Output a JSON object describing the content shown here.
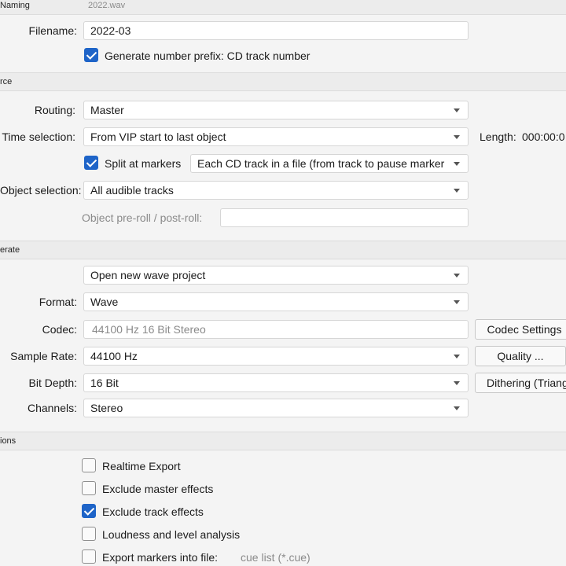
{
  "naming": {
    "section": "Naming",
    "preview": "2022.wav",
    "filename_label": "Filename:",
    "filename_value": "2022-03",
    "prefix_label": "Generate number prefix: CD track number",
    "prefix_checked": true
  },
  "source": {
    "section": "rce",
    "routing_label": "Routing:",
    "routing_value": "Master",
    "time_label": "Time selection:",
    "time_value": "From VIP start to last object",
    "length_label": "Length:",
    "length_value": "000:00:0",
    "split_label": "Split at markers",
    "split_checked": true,
    "split_mode": "Each CD track in a file (from track to pause marker",
    "object_label": "Object selection:",
    "object_value": "All audible tracks",
    "preroll_label": "Object pre-roll / post-roll:",
    "preroll_value": ""
  },
  "generate": {
    "section": "erate",
    "target_value": "Open new wave project",
    "format_label": "Format:",
    "format_value": "Wave",
    "codec_label": "Codec:",
    "codec_value": "44100 Hz 16 Bit Stereo",
    "codec_button": "Codec Settings",
    "rate_label": "Sample Rate:",
    "rate_value": "44100 Hz",
    "quality_button": "Quality ...",
    "depth_label": "Bit Depth:",
    "depth_value": "16 Bit",
    "dither_button": "Dithering (Triang",
    "channels_label": "Channels:",
    "channels_value": "Stereo"
  },
  "options": {
    "section": "ions",
    "items": [
      {
        "label": "Realtime Export",
        "checked": false
      },
      {
        "label": "Exclude master effects",
        "checked": false
      },
      {
        "label": "Exclude track effects",
        "checked": true
      },
      {
        "label": "Loudness and level analysis",
        "checked": false
      },
      {
        "label": "Export markers into file:",
        "checked": false,
        "extra": "cue list (*.cue)"
      }
    ]
  },
  "colors": {
    "accent": "#1e64c8",
    "background": "#f4f4f4",
    "section": "#ececec"
  }
}
